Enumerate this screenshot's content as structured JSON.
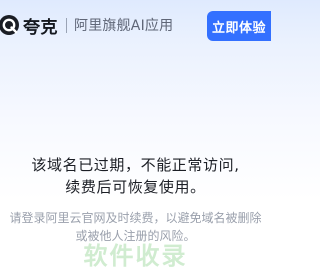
{
  "header": {
    "brand_name": "夸克",
    "brand_sub": "阿里旗舰AI应用",
    "cta_label": "立即体验",
    "brand_icon": "quark-logo-icon",
    "accent_color": "#3370ff"
  },
  "main": {
    "message_line1": "该域名已过期，不能正常访问,",
    "message_line2": "续费后可恢复使用。",
    "note_line1": "请登录阿里云官网及时续费，以避免域名被删除",
    "note_line2": "或被他人注册的风险。"
  },
  "watermark": {
    "text": "软件收录"
  }
}
